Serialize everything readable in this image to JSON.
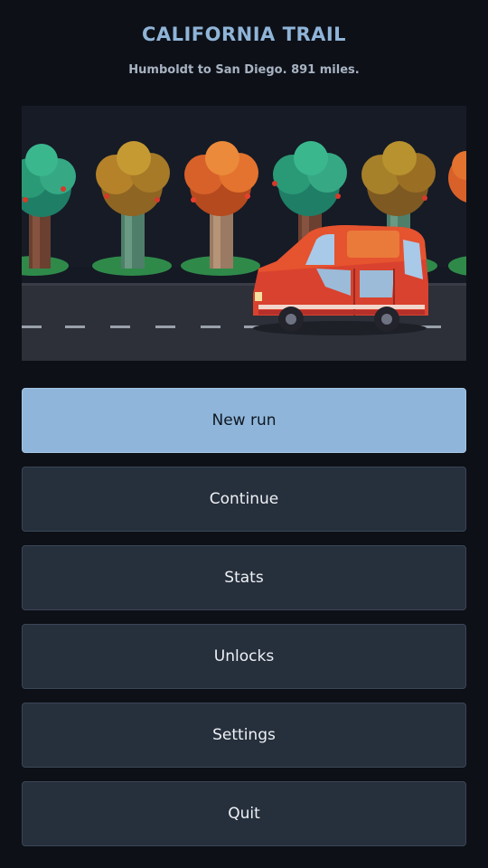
{
  "header": {
    "title": "CALIFORNIA TRAIL",
    "subtitle": "Humboldt to San Diego. 891 miles."
  },
  "scene": {
    "icons": [
      "tree-icon",
      "car-icon"
    ],
    "tree_foliage_colors": [
      "#2a9a76",
      "#b5822a",
      "#d8612a",
      "#2a9a76",
      "#a7802a",
      "#d8612a"
    ],
    "car_color": "#d9422e"
  },
  "menu": {
    "items": [
      {
        "label": "New run",
        "primary": true
      },
      {
        "label": "Continue",
        "primary": false
      },
      {
        "label": "Stats",
        "primary": false
      },
      {
        "label": "Unlocks",
        "primary": false
      },
      {
        "label": "Settings",
        "primary": false
      },
      {
        "label": "Quit",
        "primary": false
      }
    ]
  },
  "colors": {
    "background": "#0d1017",
    "accent": "#8fb6da",
    "button": "#262f3c",
    "title": "#8fb4d8"
  }
}
